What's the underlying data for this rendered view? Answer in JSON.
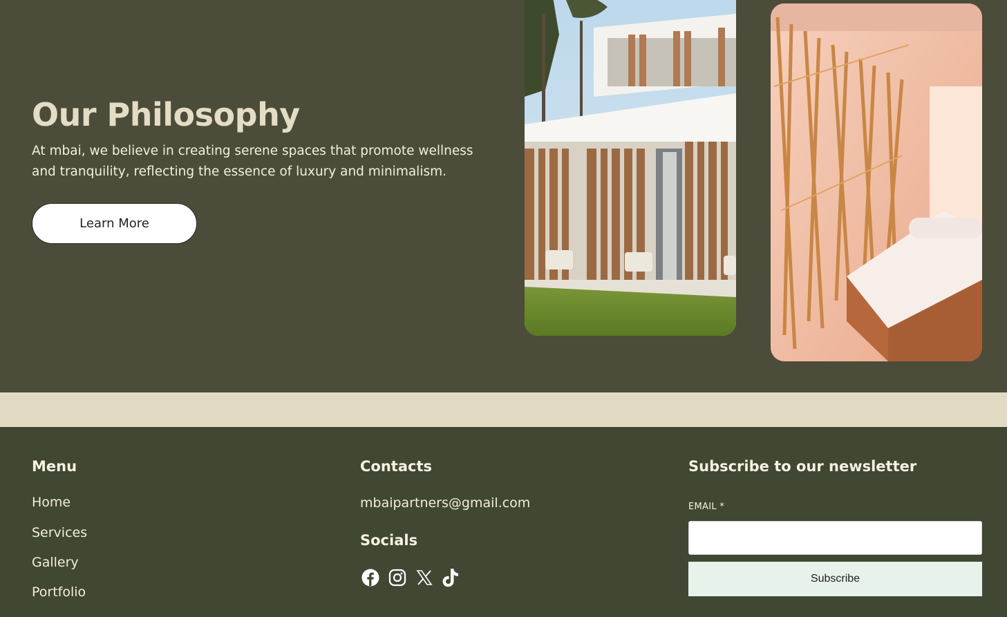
{
  "hero": {
    "title": "Our Philosophy",
    "text": "At mbai, we believe in creating serene spaces that promote wellness and tranquility, reflecting the essence of luxury and minimalism.",
    "button_label": "Learn More"
  },
  "footer": {
    "menu": {
      "title": "Menu",
      "items": [
        "Home",
        "Services",
        "Gallery",
        "Portfolio"
      ]
    },
    "contacts": {
      "title": "Contacts",
      "email": "mbaipartners@gmail.com",
      "socials_title": "Socials",
      "socials": [
        "facebook-icon",
        "instagram-icon",
        "x-icon",
        "tiktok-icon"
      ]
    },
    "newsletter": {
      "title": "Subscribe to our newsletter",
      "email_label": "EMAIL *",
      "email_value": "",
      "button_label": "Subscribe"
    }
  },
  "colors": {
    "hero_bg": "#4b4c3a",
    "band": "#e2dac3",
    "footer_bg": "#404733",
    "title": "#e4dcc4"
  }
}
